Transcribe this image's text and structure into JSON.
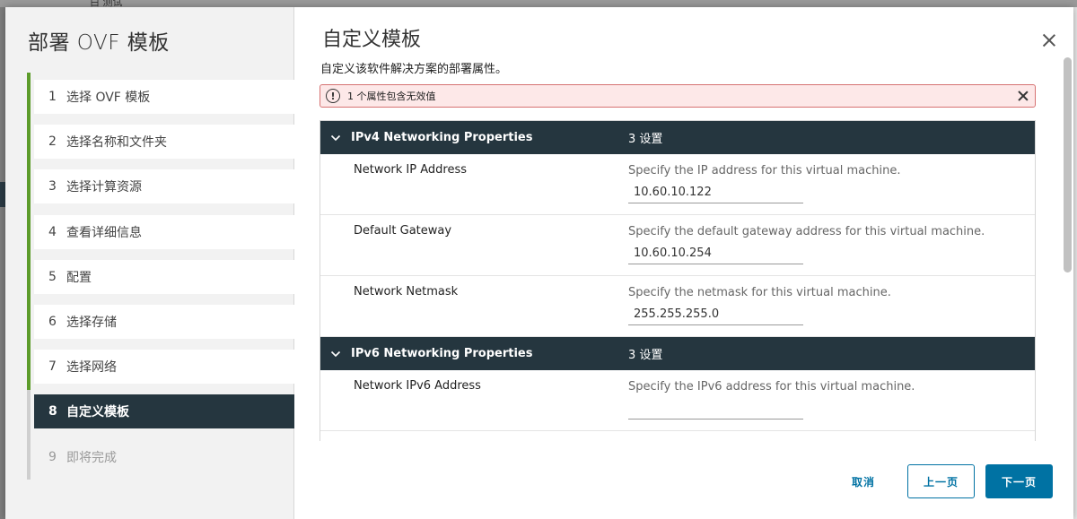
{
  "backdrop": {
    "fragment": "白 测试"
  },
  "nav": {
    "title": "部署 OVF 模板",
    "steps": [
      {
        "num": "1",
        "label": "选择 OVF 模板"
      },
      {
        "num": "2",
        "label": "选择名称和文件夹"
      },
      {
        "num": "3",
        "label": "选择计算资源"
      },
      {
        "num": "4",
        "label": "查看详细信息"
      },
      {
        "num": "5",
        "label": "配置"
      },
      {
        "num": "6",
        "label": "选择存储"
      },
      {
        "num": "7",
        "label": "选择网络"
      },
      {
        "num": "8",
        "label": "自定义模板"
      },
      {
        "num": "9",
        "label": "即将完成"
      }
    ]
  },
  "page": {
    "title": "自定义模板",
    "subtitle": "自定义该软件解决方案的部署属性。"
  },
  "alert": {
    "icon": "!",
    "text": "1 个属性包含无效值"
  },
  "groups": [
    {
      "name": "IPv4 Networking Properties",
      "count": "3 设置",
      "properties": [
        {
          "label": "Network IP Address",
          "description": "Specify the IP address for this virtual machine.",
          "value": "10.60.10.122"
        },
        {
          "label": "Default Gateway",
          "description": "Specify the default gateway address for this virtual machine.",
          "value": "10.60.10.254"
        },
        {
          "label": "Network Netmask",
          "description": "Specify the netmask for this virtual machine.",
          "value": "255.255.255.0"
        }
      ]
    },
    {
      "name": "IPv6 Networking Properties",
      "count": "3 设置",
      "properties": [
        {
          "label": "Network IPv6 Address",
          "description": "Specify the IPv6 address for this virtual machine.",
          "value": ""
        }
      ]
    }
  ],
  "footer": {
    "cancel": "取消",
    "prev": "上一页",
    "next": "下一页"
  },
  "colors": {
    "accent": "#0072a3",
    "dark_header": "#25363f",
    "progress": "#5d9c2b",
    "error_bg": "#fde8e8",
    "error_border": "#d67272"
  }
}
